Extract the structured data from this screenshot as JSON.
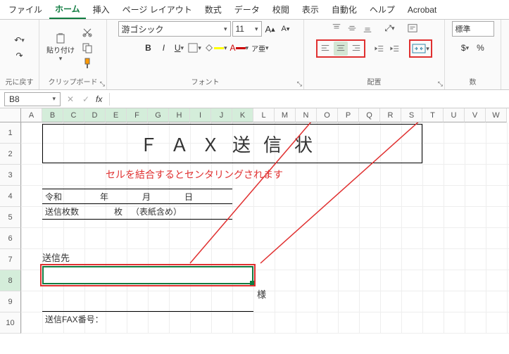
{
  "tabs": {
    "file": "ファイル",
    "home": "ホーム",
    "insert": "挿入",
    "pagelayout": "ページ レイアウト",
    "formulas": "数式",
    "data": "データ",
    "review": "校閲",
    "view": "表示",
    "automate": "自動化",
    "help": "ヘルプ",
    "acrobat": "Acrobat"
  },
  "ribbon": {
    "undo_label": "元に戻す",
    "clipboard_label": "クリップボード",
    "paste": "貼り付け",
    "font_label": "フォント",
    "font_name": "游ゴシック",
    "font_size": "11",
    "align_label": "配置",
    "number_label": "数",
    "number_format": "標準"
  },
  "namebox": {
    "cell": "B8"
  },
  "cols": [
    "A",
    "B",
    "C",
    "D",
    "E",
    "F",
    "G",
    "H",
    "I",
    "J",
    "K",
    "L",
    "M",
    "N",
    "O",
    "P",
    "Q",
    "R",
    "S",
    "T",
    "U",
    "V",
    "W"
  ],
  "rows": [
    "1",
    "2",
    "3",
    "4",
    "5",
    "6",
    "7",
    "8",
    "9",
    "10"
  ],
  "doc": {
    "title": "ＦＡＸ送信状",
    "annotation": "セルを結合するとセンタリングされます",
    "era": "令和",
    "year_lbl": "年",
    "month_lbl": "月",
    "day_lbl": "日",
    "count_lbl": "送信枚数",
    "sheets_lbl": "枚",
    "cover_note": "（表紙含め）",
    "sendto": "送信先",
    "sama": "様",
    "faxno": "送信FAX番号："
  }
}
